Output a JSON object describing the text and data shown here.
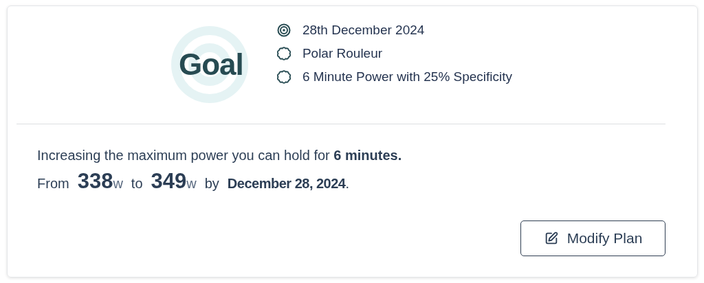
{
  "goal": {
    "title": "Goal",
    "details": [
      {
        "kind": "target",
        "text": "28th December 2024"
      },
      {
        "kind": "badge",
        "text": "Polar Rouleur"
      },
      {
        "kind": "badge",
        "text": "6 Minute Power with 25% Specificity"
      }
    ]
  },
  "summary": {
    "sentence": "Increasing the maximum power you can hold for **6 minutes.**",
    "range": {
      "from_label": "From",
      "start_value": "338",
      "start_unit": "w",
      "to_label": "to",
      "end_value": "349",
      "end_unit": "w",
      "by_label": "by",
      "date": "December 28, 2024",
      "end": "."
    }
  },
  "button": {
    "label": "Modify Plan"
  }
}
